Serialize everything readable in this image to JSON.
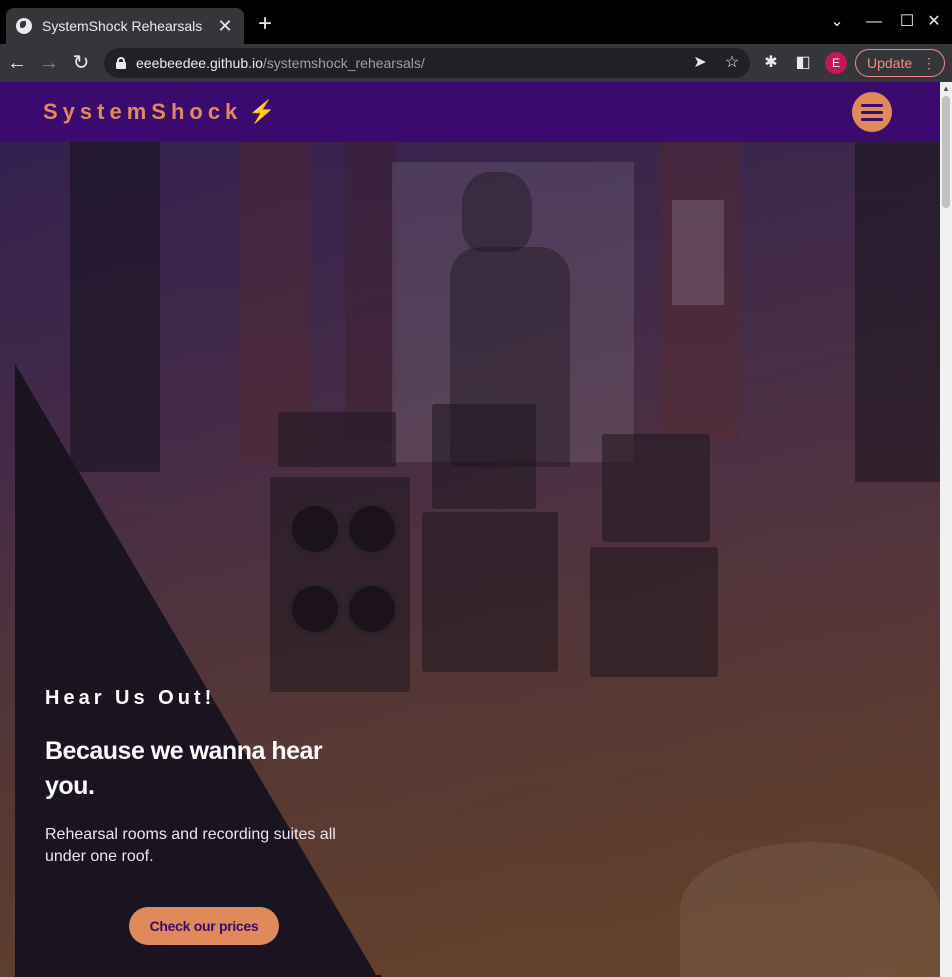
{
  "browser": {
    "tab_title": "SystemShock Rehearsals",
    "tab_close": "✕",
    "new_tab": "+",
    "url_host": "eeebeedee.github.io",
    "url_path": "/systemshock_rehearsals/",
    "profile_initial": "E",
    "update_label": "Update",
    "update_menu": "⋮",
    "window_controls": {
      "chevron": "⌄",
      "minimize": "—",
      "maximize": "☐",
      "close": "✕"
    },
    "nav": {
      "back": "←",
      "forward": "→",
      "reload": "↻"
    },
    "omni_icons": {
      "send": "➤",
      "star": "☆"
    },
    "toolbar_icons": {
      "extensions": "✱",
      "sidepanel": "◧"
    }
  },
  "site": {
    "brand": "SystemShock",
    "brand_icon": "⚡",
    "tagline": "Hear Us Out!",
    "headline": "Because we wanna hear you.",
    "subtext": "Rehearsal rooms and recording suites all under one roof.",
    "cta_label": "Check our prices"
  },
  "colors": {
    "nav_bg": "#3a0a6e",
    "accent": "#e08a5c",
    "panel": "#1a1320"
  }
}
